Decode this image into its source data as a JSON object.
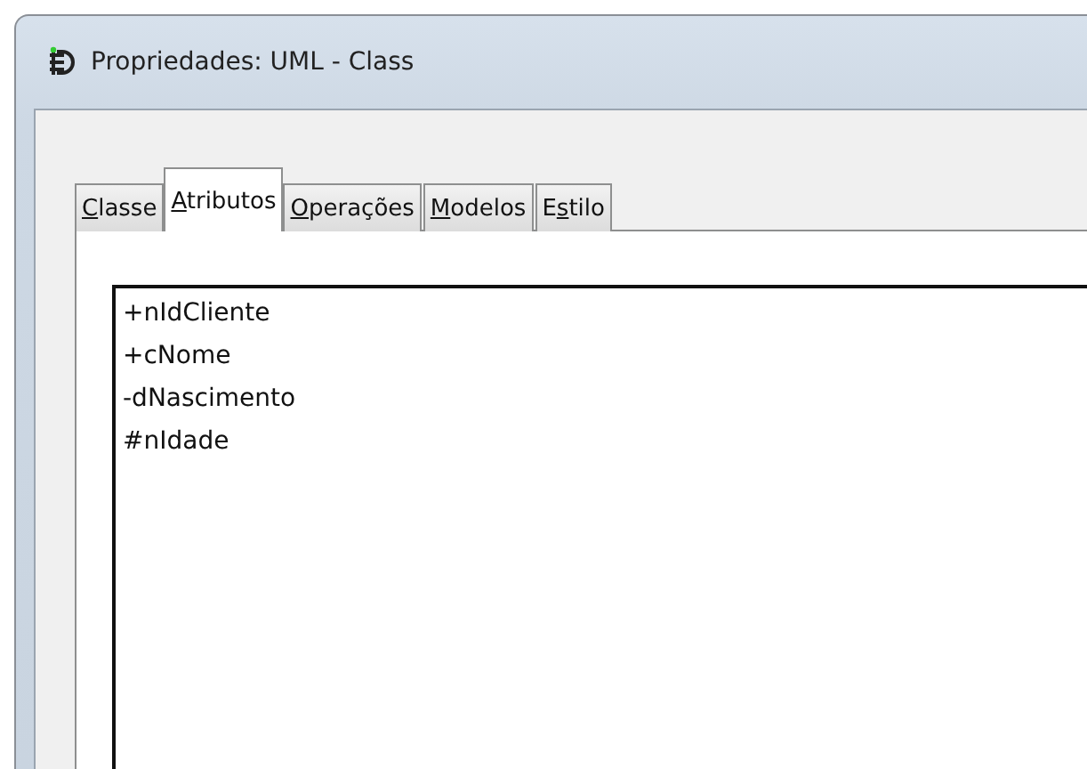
{
  "window": {
    "title": "Propriedades: UML - Class"
  },
  "tabs": [
    {
      "access_key": "C",
      "after_key": "lasse",
      "selected": false
    },
    {
      "access_key": "A",
      "after_key": "tributos",
      "selected": true
    },
    {
      "access_key": "O",
      "after_key": "perações",
      "selected": false
    },
    {
      "access_key": "M",
      "after_key": "odelos",
      "selected": false
    },
    {
      "before_key": "E",
      "access_key": "s",
      "after_key": "tilo",
      "selected": false
    }
  ],
  "attributes": {
    "items": [
      "+nIdCliente",
      "+cNome",
      "-dNascimento",
      "#nIdade"
    ]
  }
}
